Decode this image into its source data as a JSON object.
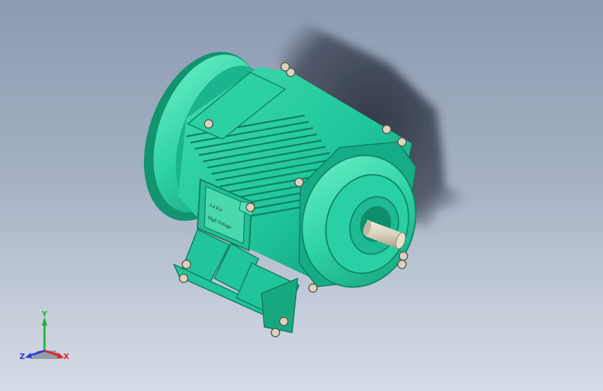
{
  "viewport": {
    "background_top": "#8d9bb1",
    "background_bottom": "#d6dce5"
  },
  "model": {
    "body_color": "#1fc59a",
    "body_dark": "#12946f",
    "body_light": "#5ee8bf",
    "shaft_color": "#d8d2bc",
    "nameplate_lines": [
      "3.4 Kw",
      "High Voltage"
    ]
  },
  "triad": {
    "x_label": "X",
    "y_label": "Y",
    "z_label": "Z",
    "x_color": "#e0242c",
    "y_color": "#1fb33a",
    "z_color": "#2a3fd6"
  }
}
